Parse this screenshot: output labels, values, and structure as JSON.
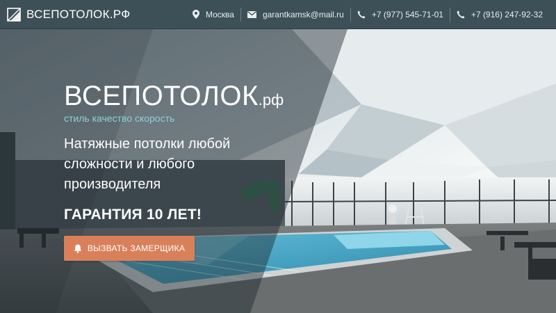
{
  "header": {
    "logo_text": "ВСЕПОТОЛОК.РФ",
    "contacts": [
      {
        "icon": "map-pin-icon",
        "text": "Москва"
      },
      {
        "icon": "mail-icon",
        "text": "garantkamsk@mail.ru"
      },
      {
        "icon": "phone-icon",
        "text": "+7 (977) 545-71-01"
      },
      {
        "icon": "phone-icon",
        "text": "+7 (916) 247-92-32"
      }
    ]
  },
  "hero": {
    "brand_main": "ВСЕПОТОЛОК",
    "brand_suffix": ".рф",
    "tagline": "стиль качество скорость",
    "headline": "Натяжные потолки любой сложности и любого производителя",
    "guarantee": "ГАРАНТИЯ 10 ЛЕТ!",
    "cta_label": "ВЫЗВАТЬ ЗАМЕРЩИКА",
    "cta_icon": "bell-icon"
  },
  "colors": {
    "topbar": "#3d5058",
    "tagline": "#8fd0dc",
    "cta": "#d9805a"
  }
}
